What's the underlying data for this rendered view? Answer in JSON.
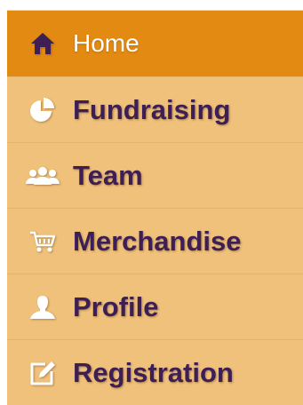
{
  "nav": {
    "items": [
      {
        "label": "Home",
        "icon": "home-icon",
        "active": true
      },
      {
        "label": "Fundraising",
        "icon": "pie-chart-icon",
        "active": false
      },
      {
        "label": "Team",
        "icon": "team-icon",
        "active": false
      },
      {
        "label": "Merchandise",
        "icon": "shopping-cart-icon",
        "active": false
      },
      {
        "label": "Profile",
        "icon": "user-icon",
        "active": false
      },
      {
        "label": "Registration",
        "icon": "edit-icon",
        "active": false
      }
    ]
  },
  "colors": {
    "active_bg": "#e28a12",
    "item_bg": "#f0c17b",
    "label_text": "#3e1f55",
    "active_text": "#ffffff"
  }
}
